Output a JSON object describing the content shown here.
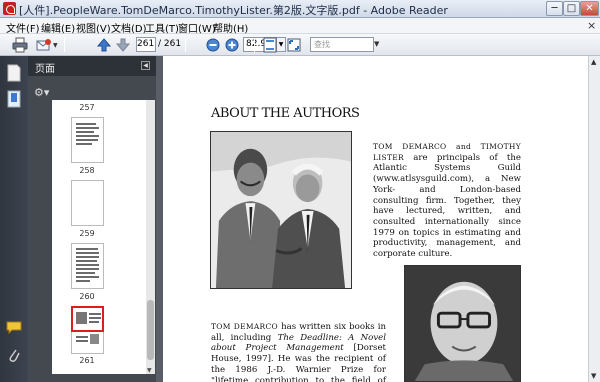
{
  "window": {
    "title": "[人件].PeopleWare.TomDeMarco.TimothyLister.第2版.文字版.pdf - Adobe Reader",
    "min_glyph": "─",
    "max_glyph": "□",
    "close_glyph": "✕"
  },
  "menu": {
    "items": [
      "文件(F)",
      "编辑(E)",
      "视图(V)",
      "文档(D)",
      "工具(T)",
      "窗口(W)",
      "帮助(H)"
    ],
    "close_glyph": "×"
  },
  "toolbar": {
    "icons": [
      "print-icon",
      "email-icon",
      "previous-page-icon",
      "next-page-icon",
      "zoom-out-icon",
      "zoom-in-icon",
      "fit-page-icon",
      "full-screen-icon"
    ],
    "page_number": "261",
    "page_total": "/ 261",
    "zoom": "82.9%",
    "search_placeholder": "查找"
  },
  "sidebar": {
    "title": "页面",
    "options_glyph": "⚙▾",
    "collapse_glyph": "◀",
    "thumbnails": [
      {
        "label": "257",
        "type": "label-only"
      },
      {
        "label": "258",
        "type": "text"
      },
      {
        "label": "259",
        "type": "blank"
      },
      {
        "label": "260",
        "type": "text"
      },
      {
        "label": "261",
        "type": "authors",
        "current": true
      }
    ]
  },
  "document": {
    "heading": "ABOUT THE AUTHORS",
    "bio1_names": "TOM DEMARCO and TIMOTHY LISTER",
    "bio1_rest": " are principals of the Atlantic Systems Guild (www.atlsysguild.com), a New York- and London-based consulting firm. Together, they have lectured, written, and consulted internationally since 1979 on topics in estimating and productivity, management, and corporate culture.",
    "bio2_name": "TOM DEMARCO",
    "bio2_a": " has written six books in all, including ",
    "bio2_title": "The Deadline: A Novel about Project Management",
    "bio2_b": " [Dorset House, 1997]. He was the recipient of the 1986 J.-D. Warnier Prize for \"lifetime contribution to the field of computing.\""
  },
  "colors": {
    "current_thumb_border": "#d82020",
    "navpanel": "#353b44",
    "sidepanel": "#44484f"
  }
}
